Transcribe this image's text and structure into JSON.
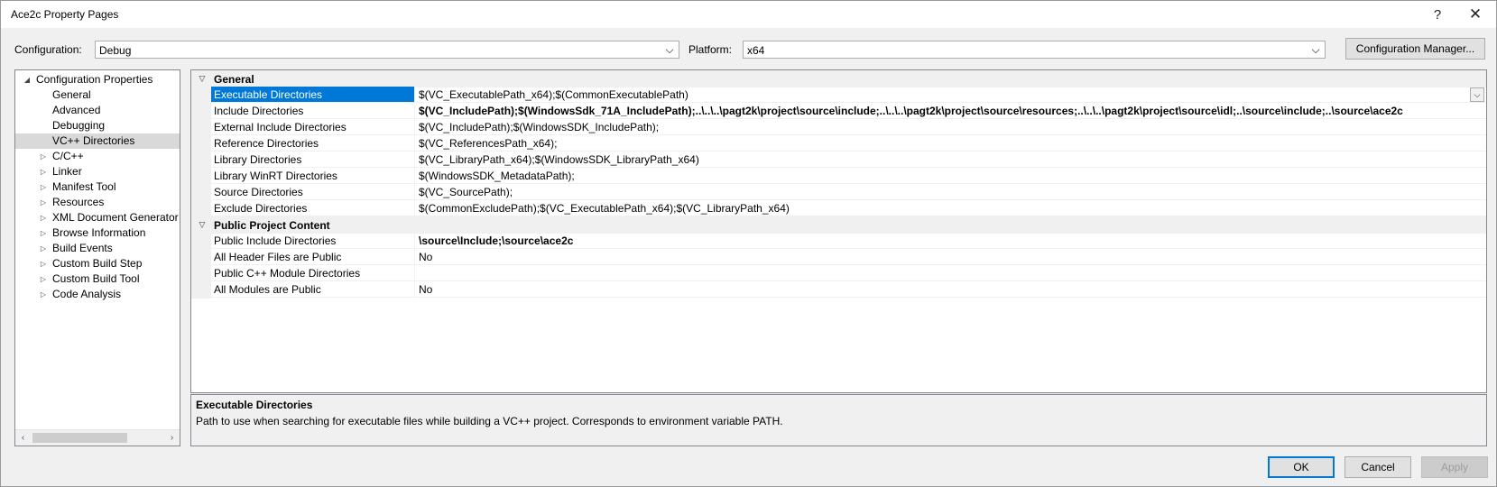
{
  "window": {
    "title": "Ace2c Property Pages",
    "help_glyph": "?",
    "close_glyph": "✕"
  },
  "config": {
    "label": "Configuration:",
    "value": "Debug",
    "platform_label": "Platform:",
    "platform_value": "x64",
    "manager_button": "Configuration Manager..."
  },
  "tree": {
    "items": [
      {
        "label": "Configuration Properties",
        "expander": "◢"
      },
      {
        "label": "General"
      },
      {
        "label": "Advanced"
      },
      {
        "label": "Debugging"
      },
      {
        "label": "VC++ Directories",
        "selected": true
      },
      {
        "label": "C/C++",
        "expander": "▷"
      },
      {
        "label": "Linker",
        "expander": "▷"
      },
      {
        "label": "Manifest Tool",
        "expander": "▷"
      },
      {
        "label": "Resources",
        "expander": "▷"
      },
      {
        "label": "XML Document Generator",
        "expander": "▷"
      },
      {
        "label": "Browse Information",
        "expander": "▷"
      },
      {
        "label": "Build Events",
        "expander": "▷"
      },
      {
        "label": "Custom Build Step",
        "expander": "▷"
      },
      {
        "label": "Custom Build Tool",
        "expander": "▷"
      },
      {
        "label": "Code Analysis",
        "expander": "▷"
      }
    ],
    "scroll_left": "‹",
    "scroll_right": "›"
  },
  "grid": {
    "categories": [
      {
        "label": "General",
        "arrow": "▽",
        "rows": [
          {
            "name": "Executable Directories",
            "value": "$(VC_ExecutablePath_x64);$(CommonExecutablePath)",
            "selected": true
          },
          {
            "name": "Include Directories",
            "value": "$(VC_IncludePath);$(WindowsSdk_71A_IncludePath);..\\..\\..\\pagt2k\\project\\source\\include;..\\..\\..\\pagt2k\\project\\source\\resources;..\\..\\..\\pagt2k\\project\\source\\idl;..\\source\\include;..\\source\\ace2c",
            "bold": true
          },
          {
            "name": "External Include Directories",
            "value": "$(VC_IncludePath);$(WindowsSDK_IncludePath);"
          },
          {
            "name": "Reference Directories",
            "value": "$(VC_ReferencesPath_x64);"
          },
          {
            "name": "Library Directories",
            "value": "$(VC_LibraryPath_x64);$(WindowsSDK_LibraryPath_x64)"
          },
          {
            "name": "Library WinRT Directories",
            "value": "$(WindowsSDK_MetadataPath);"
          },
          {
            "name": "Source Directories",
            "value": "$(VC_SourcePath);"
          },
          {
            "name": "Exclude Directories",
            "value": "$(CommonExcludePath);$(VC_ExecutablePath_x64);$(VC_LibraryPath_x64)"
          }
        ]
      },
      {
        "label": "Public Project Content",
        "arrow": "▽",
        "rows": [
          {
            "name": "Public Include Directories",
            "value": "\\source\\Include;\\source\\ace2c",
            "bold": true
          },
          {
            "name": "All Header Files are Public",
            "value": "No"
          },
          {
            "name": "Public C++ Module Directories",
            "value": ""
          },
          {
            "name": "All Modules are Public",
            "value": "No"
          }
        ]
      }
    ],
    "dropdown_glyph": "⌵"
  },
  "description": {
    "title": "Executable Directories",
    "text": "Path to use when searching for executable files while building a VC++ project.  Corresponds to environment variable PATH."
  },
  "buttons": {
    "ok": "OK",
    "cancel": "Cancel",
    "apply": "Apply"
  },
  "combo_arrow": "⌵"
}
